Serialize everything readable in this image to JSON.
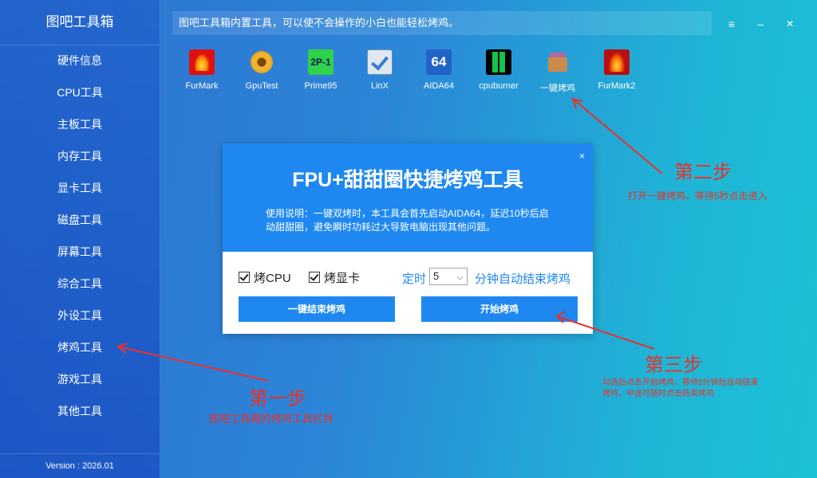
{
  "sidebar": {
    "title": "图吧工具箱",
    "items": [
      {
        "label": "硬件信息"
      },
      {
        "label": "CPU工具"
      },
      {
        "label": "主板工具"
      },
      {
        "label": "内存工具"
      },
      {
        "label": "显卡工具"
      },
      {
        "label": "磁盘工具"
      },
      {
        "label": "屏幕工具"
      },
      {
        "label": "综合工具"
      },
      {
        "label": "外设工具"
      },
      {
        "label": "烤鸡工具"
      },
      {
        "label": "游戏工具"
      },
      {
        "label": "其他工具"
      }
    ],
    "version": "Version : 2026.01"
  },
  "topbar": {
    "text": "图吧工具箱内置工具，可以使不会操作的小白也能轻松烤鸡。"
  },
  "window_controls": {
    "menu": "≡",
    "minimize": "–",
    "close": "✕"
  },
  "tools": [
    {
      "label": "FurMark",
      "icon": "furmark-icon"
    },
    {
      "label": "GpuTest",
      "icon": "gputest-icon"
    },
    {
      "label": "Prime95",
      "icon": "prime95-icon",
      "glyph": "2P-1"
    },
    {
      "label": "LinX",
      "icon": "linx-icon"
    },
    {
      "label": "AIDA64",
      "icon": "aida64-icon",
      "glyph": "64"
    },
    {
      "label": "cpuburner",
      "icon": "cpuburner-icon"
    },
    {
      "label": "一键烤鸡",
      "icon": "one-key-burn-icon"
    },
    {
      "label": "FurMark2",
      "icon": "furmark2-icon"
    }
  ],
  "dialog": {
    "title": "FPU+甜甜圈快捷烤鸡工具",
    "description": "使用说明：一键双烤时，本工具会首先启动AIDA64，延迟10秒后启动甜甜圈，避免瞬时功耗过大导致电脑出现其他问题。",
    "close": "×",
    "option_cpu": "烤CPU",
    "option_gpu": "烤显卡",
    "timer_prefix": "定时",
    "timer_value": "5",
    "timer_suffix": "分钟自动结束烤鸡",
    "stop_button": "一键结束烤鸡",
    "start_button": "开始烤鸡"
  },
  "annotations": {
    "step1_title": "第一步",
    "step1_desc": "图吧工具箱的烤鸡工具栏目",
    "step2_title": "第二步",
    "step2_desc": "打开一键烤鸡，等待5秒点击进入",
    "step3_title": "第三步",
    "step3_desc": "勾选后点击开始烤鸡，等待5分钟后自动结束烤鸡，中途可随时点击结束烤鸡"
  },
  "colors": {
    "accent": "#1e88f0",
    "annotation": "#e8312c"
  }
}
